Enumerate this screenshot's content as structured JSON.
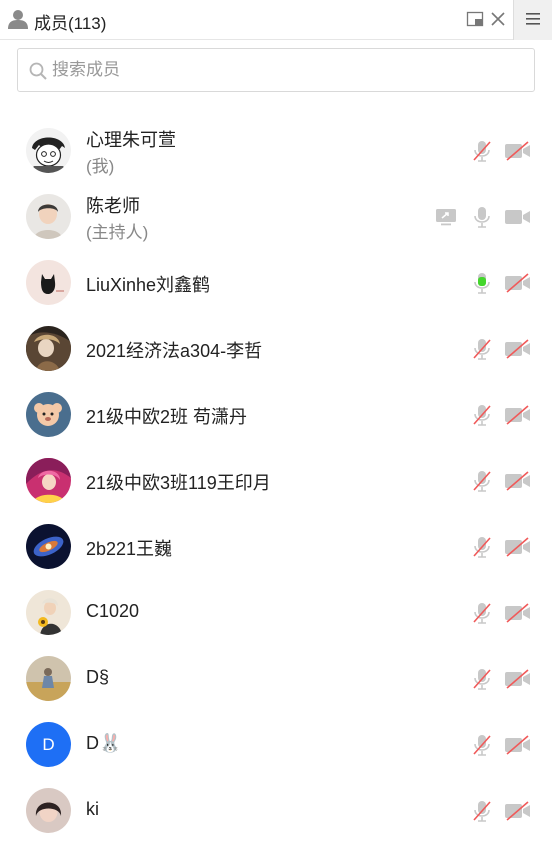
{
  "header": {
    "title": "成员(113)"
  },
  "search": {
    "placeholder": "搜索成员",
    "value": ""
  },
  "members": [
    {
      "name": "心理朱可萱",
      "role": "(我)",
      "mic": "muted",
      "camera": "off",
      "avatar": "comic-boy"
    },
    {
      "name": "陈老师",
      "role": "(主持人)",
      "mic": "idle",
      "camera": "idle",
      "sharing": true,
      "avatar": "child-photo"
    },
    {
      "name": "LiuXinhe刘鑫鹤",
      "role": "",
      "mic": "speaking",
      "camera": "off",
      "avatar": "black-cat"
    },
    {
      "name": "2021经济法a304-李哲",
      "role": "",
      "mic": "muted",
      "camera": "off",
      "avatar": "anime-dark"
    },
    {
      "name": "21级中欧2班 苟潇丹",
      "role": "",
      "mic": "muted",
      "camera": "off",
      "avatar": "cartoon-dog"
    },
    {
      "name": "21级中欧3班119王印月",
      "role": "",
      "mic": "muted",
      "camera": "off",
      "avatar": "anime-pink"
    },
    {
      "name": "2b221王巍",
      "role": "",
      "mic": "muted",
      "camera": "off",
      "avatar": "galaxy"
    },
    {
      "name": "C1020",
      "role": "",
      "mic": "muted",
      "camera": "off",
      "avatar": "sunflower-girl"
    },
    {
      "name": "D§",
      "role": "",
      "mic": "muted",
      "camera": "off",
      "avatar": "field-photo"
    },
    {
      "name": "D🐰",
      "role": "",
      "mic": "muted",
      "camera": "off",
      "avatar": "letter",
      "avatar_letter": "D"
    },
    {
      "name": "ki",
      "role": "",
      "mic": "muted",
      "camera": "off",
      "avatar": "girl-photo"
    }
  ],
  "colors": {
    "muted_slash": "#f05a5a",
    "speaking": "#44d62c",
    "icon_gray": "#c8c8c8",
    "letter_avatar": "#1e6ff5"
  }
}
